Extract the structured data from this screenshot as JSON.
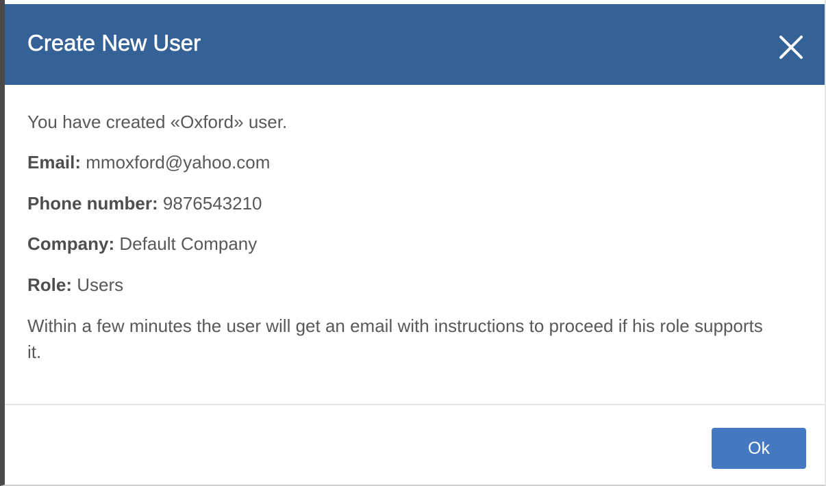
{
  "dialog": {
    "title": "Create New User",
    "close_icon": "close-icon"
  },
  "message": {
    "created_text": "You have created «Oxford» user.",
    "email_label": "Email:",
    "email_value": "mmoxford@yahoo.com",
    "phone_label": "Phone number:",
    "phone_value": "9876543210",
    "company_label": "Company:",
    "company_value": "Default Company",
    "role_label": "Role:",
    "role_value": "Users",
    "info_text": "Within a few minutes the user will get an email with instructions to proceed if his role supports it."
  },
  "footer": {
    "ok_label": "Ok"
  },
  "colors": {
    "header_bg": "#356296",
    "ok_button_bg": "#4479c1",
    "text": "#585858"
  }
}
